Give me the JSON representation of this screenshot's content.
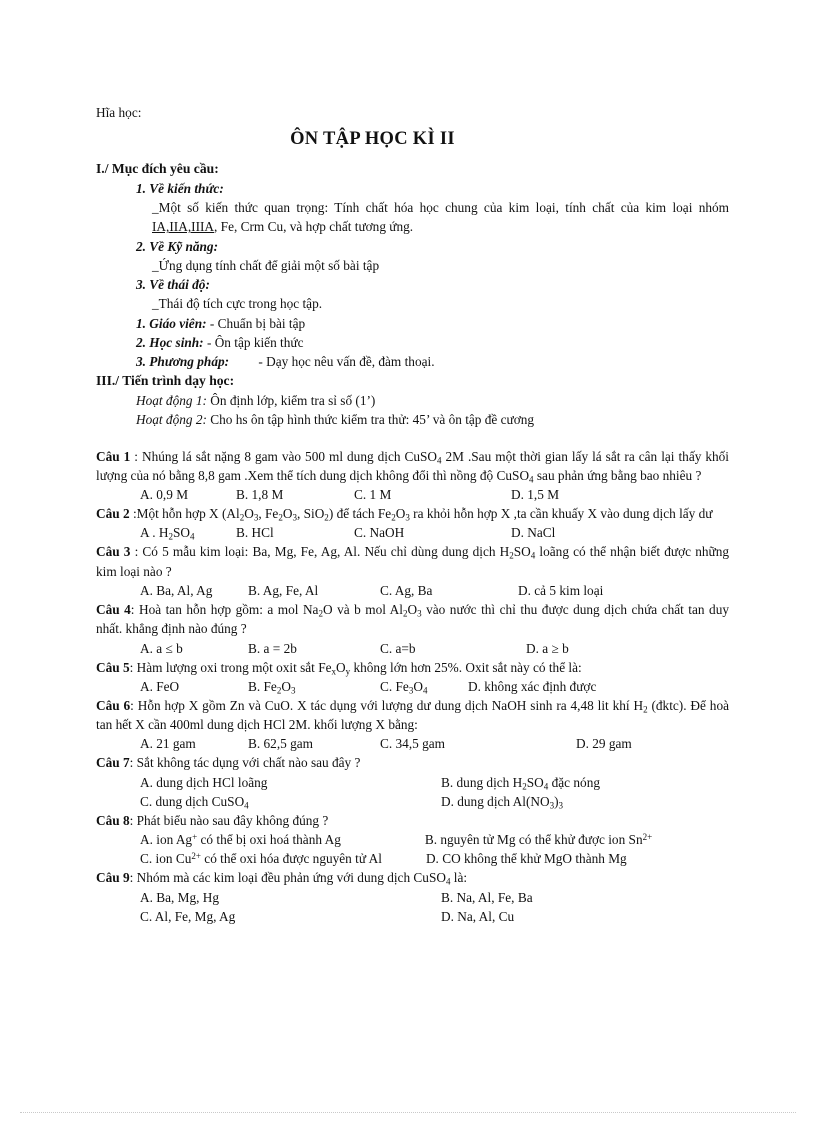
{
  "document": {
    "header_left": "Hĩa học:",
    "title": "ÔN TẬP HỌC KÌ II",
    "sections": {
      "s1_heading": "I./ Mục đích yêu cầu:",
      "s1_1_label": "1. Về kiến thức:",
      "s1_1_text_a": "_Một số kiến thức quan trọng: Tính chất hóa học chung của kim loại, tính chất của kim loại nhóm ",
      "s1_1_text_underline": "IA,IIA,IIIA",
      "s1_1_text_b": ", Fe, Crm Cu, và hợp chất tương ứng.",
      "s1_2_label": "2. Về Kỹ năng:",
      "s1_2_text": "_Ứng dụng tính chất để giải một số bài tập",
      "s1_3_label": "3. Về thái độ:",
      "s1_3_text": "_Thái độ tích cực trong học tập.",
      "prep_1_label": "1. Giáo viên:",
      "prep_1_text": "- Chuẩn bị bài tập",
      "prep_2_label": "2. Học sinh:",
      "prep_2_text": "- Ôn tập kiến thức",
      "prep_3_label": "3. Phương pháp:",
      "prep_3_text": "- Dạy học nêu vấn đề, đàm thoại.",
      "s3_heading": "III./ Tiến trình dạy học:",
      "act1_label": "Hoạt động 1:",
      "act1_text": "Ôn định lớp, kiểm tra sỉ số (1’)",
      "act2_label": "Hoạt động 2:",
      "act2_text": "Cho hs ôn tập hình thức kiểm tra thử: 45’ và ôn tập đề cương"
    }
  },
  "questions": [
    {
      "number": "Câu 1",
      "stem_prefix": " : Nhúng lá sắt nặng 8 gam vào 500 ml dung dịch CuSO",
      "stem_sub1": "4",
      "stem_mid": " 2M .Sau một thời gian lấy lá sắt ra cân lại thấy khối lượng của nó bằng 8,8 gam .Xem thể tích dung dịch không đổi thì nồng độ CuSO",
      "stem_sub2": "4",
      "stem_suffix": " sau phản ứng bằng bao nhiêu ?",
      "layout": "four-col",
      "options": [
        "A. 0,9 M",
        "B. 1,8 M",
        "C. 1 M",
        "D. 1,5 M"
      ]
    },
    {
      "number": "Câu 2",
      "layout": "four-col",
      "options": [
        "A . H2SO4",
        "B. HCl",
        "C. NaOH",
        "D. NaCl"
      ]
    },
    {
      "number": "Câu 3",
      "layout": "four-col",
      "options": [
        "A. Ba, Al, Ag",
        "B. Ag, Fe, Al",
        "C. Ag, Ba",
        "D. cả 5 kim loại"
      ]
    },
    {
      "number": "Câu 4",
      "layout": "four-col",
      "options": [
        "A. a ≤ b",
        "B. a = 2b",
        "C. a=b",
        "D. a ≥ b"
      ]
    },
    {
      "number": "Câu 5",
      "layout": "four-col",
      "options": [
        "A. FeO",
        "B. Fe2O3",
        "C. Fe3O4",
        "D. không xác định được"
      ]
    },
    {
      "number": "Câu 6",
      "layout": "four-col",
      "options": [
        "A. 21 gam",
        "B. 62,5 gam",
        "C. 34,5 gam",
        "D. 29 gam"
      ]
    },
    {
      "number": "Câu 7",
      "layout": "two-col",
      "options": [
        "A. dung dịch HCl loãng",
        "B. dung dịch H2SO4 đặc nóng",
        "C. dung dịch CuSO4",
        "D. dung dịch Al(NO3)3"
      ]
    },
    {
      "number": "Câu 8",
      "layout": "two-col-wrap",
      "options": [
        "A. ion Ag+ có thể bị oxi hoá thành Ag",
        "B. nguyên tử Mg có thể khử được ion Sn2+",
        "C. ion Cu2+ có thể oxi hóa được nguyên tử Al",
        "D. CO không thể khử MgO thành Mg"
      ]
    },
    {
      "number": "Câu 9",
      "layout": "two-col",
      "options": [
        "A. Ba, Mg, Hg",
        "B. Na, Al, Fe, Ba",
        "C. Al, Fe, Mg, Ag",
        "D. Na, Al, Cu"
      ]
    }
  ],
  "q2": {
    "stem_a": " :Một hỗn hợp X (Al",
    "s1": "2",
    "stem_b": "O",
    "s2": "3",
    "stem_c": ", Fe",
    "s3": "2",
    "stem_d": "O",
    "s4": "3",
    "stem_e": ", SiO",
    "s5": "2",
    "stem_f": ") để tách Fe",
    "s6": "2",
    "stem_g": "O",
    "s7": "3",
    "stem_h": " ra khỏi hỗn hợp X ,ta cần khuấy X vào dung dịch lấy dư"
  },
  "q3": {
    "stem_a": " : Có 5 mẫu kim loại: Ba, Mg, Fe, Ag, Al. Nếu chỉ dùng dung dịch H",
    "s1": "2",
    "stem_b": "SO",
    "s2": "4",
    "stem_c": " loãng có thể nhận biết được những kim loại nào ?"
  },
  "q4": {
    "stem_a": ": Hoà tan hỗn hợp gồm: a mol Na",
    "s1": "2",
    "stem_b": "O và b mol Al",
    "s2": "2",
    "stem_c": "O",
    "s3": "3",
    "stem_d": " vào nước thì chỉ thu được dung dịch chứa chất tan duy nhất. khẳng định nào đúng ?"
  },
  "q5": {
    "stem_a": ": Hàm lượng oxi trong một oxit sắt Fe",
    "s1": "x",
    "stem_b": "O",
    "s2": "y",
    "stem_c": " không lớn hơn 25%. Oxit sắt này có thể là:"
  },
  "q6": {
    "stem_a": ": Hỗn hợp X gồm Zn và CuO. X tác dụng với lượng dư dung dịch NaOH sinh ra 4,48 lit khí H",
    "s1": "2",
    "stem_b": " (đktc). Để hoà tan hết X cần 400ml dung dịch HCl 2M. khối lượng X bằng:"
  },
  "q7": {
    "stem": ": Sắt không tác dụng với chất nào sau đây ?"
  },
  "q8": {
    "stem": ": Phát biểu nào sau đây không đúng ?"
  },
  "q9": {
    "stem_a": ": Nhóm mà các kim loại đều phản ứng với dung dịch CuSO",
    "s1": "4",
    "stem_b": " là:"
  }
}
